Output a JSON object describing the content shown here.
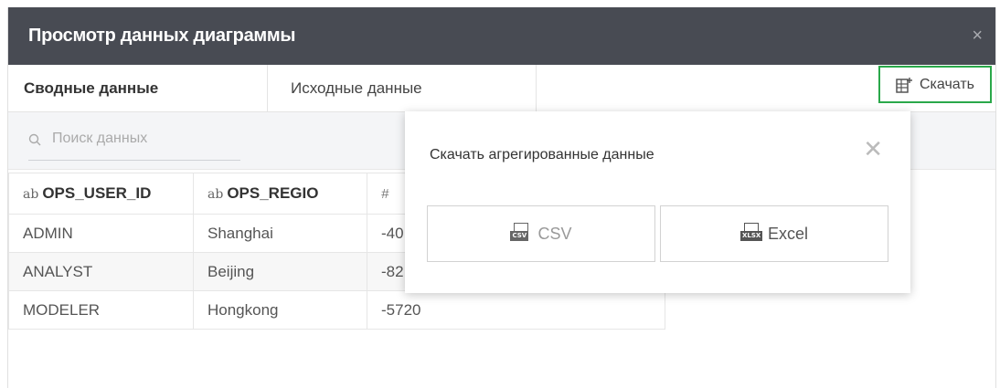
{
  "dialog": {
    "title": "Просмотр данных диаграммы",
    "close": "×"
  },
  "tabs": [
    {
      "label": "Сводные данные",
      "active": true
    },
    {
      "label": "Исходные данные",
      "active": false
    }
  ],
  "download": {
    "label": "Скачать",
    "highlight_color": "#2aa84a",
    "icon": "spreadsheet-download-icon"
  },
  "search": {
    "placeholder": "Поиск данных",
    "value": "",
    "icon": "search-icon"
  },
  "table": {
    "columns": [
      {
        "type": "ab",
        "name": "OPS_USER_ID"
      },
      {
        "type": "ab",
        "name": "OPS_REGIO"
      },
      {
        "type": "#",
        "name": ""
      }
    ],
    "rows": [
      [
        "ADMIN",
        "Shanghai",
        "-40"
      ],
      [
        "ANALYST",
        "Beijing",
        "-82"
      ],
      [
        "MODELER",
        "Hongkong",
        "-5720"
      ]
    ]
  },
  "popup": {
    "title": "Скачать агрегированные данные",
    "close": "✕",
    "buttons": [
      {
        "label": "CSV",
        "icon_label": "CSV"
      },
      {
        "label": "Excel",
        "icon_label": "XLSX"
      }
    ]
  },
  "colors": {
    "titlebar": "#484b53",
    "accent": "#2aa84a"
  }
}
